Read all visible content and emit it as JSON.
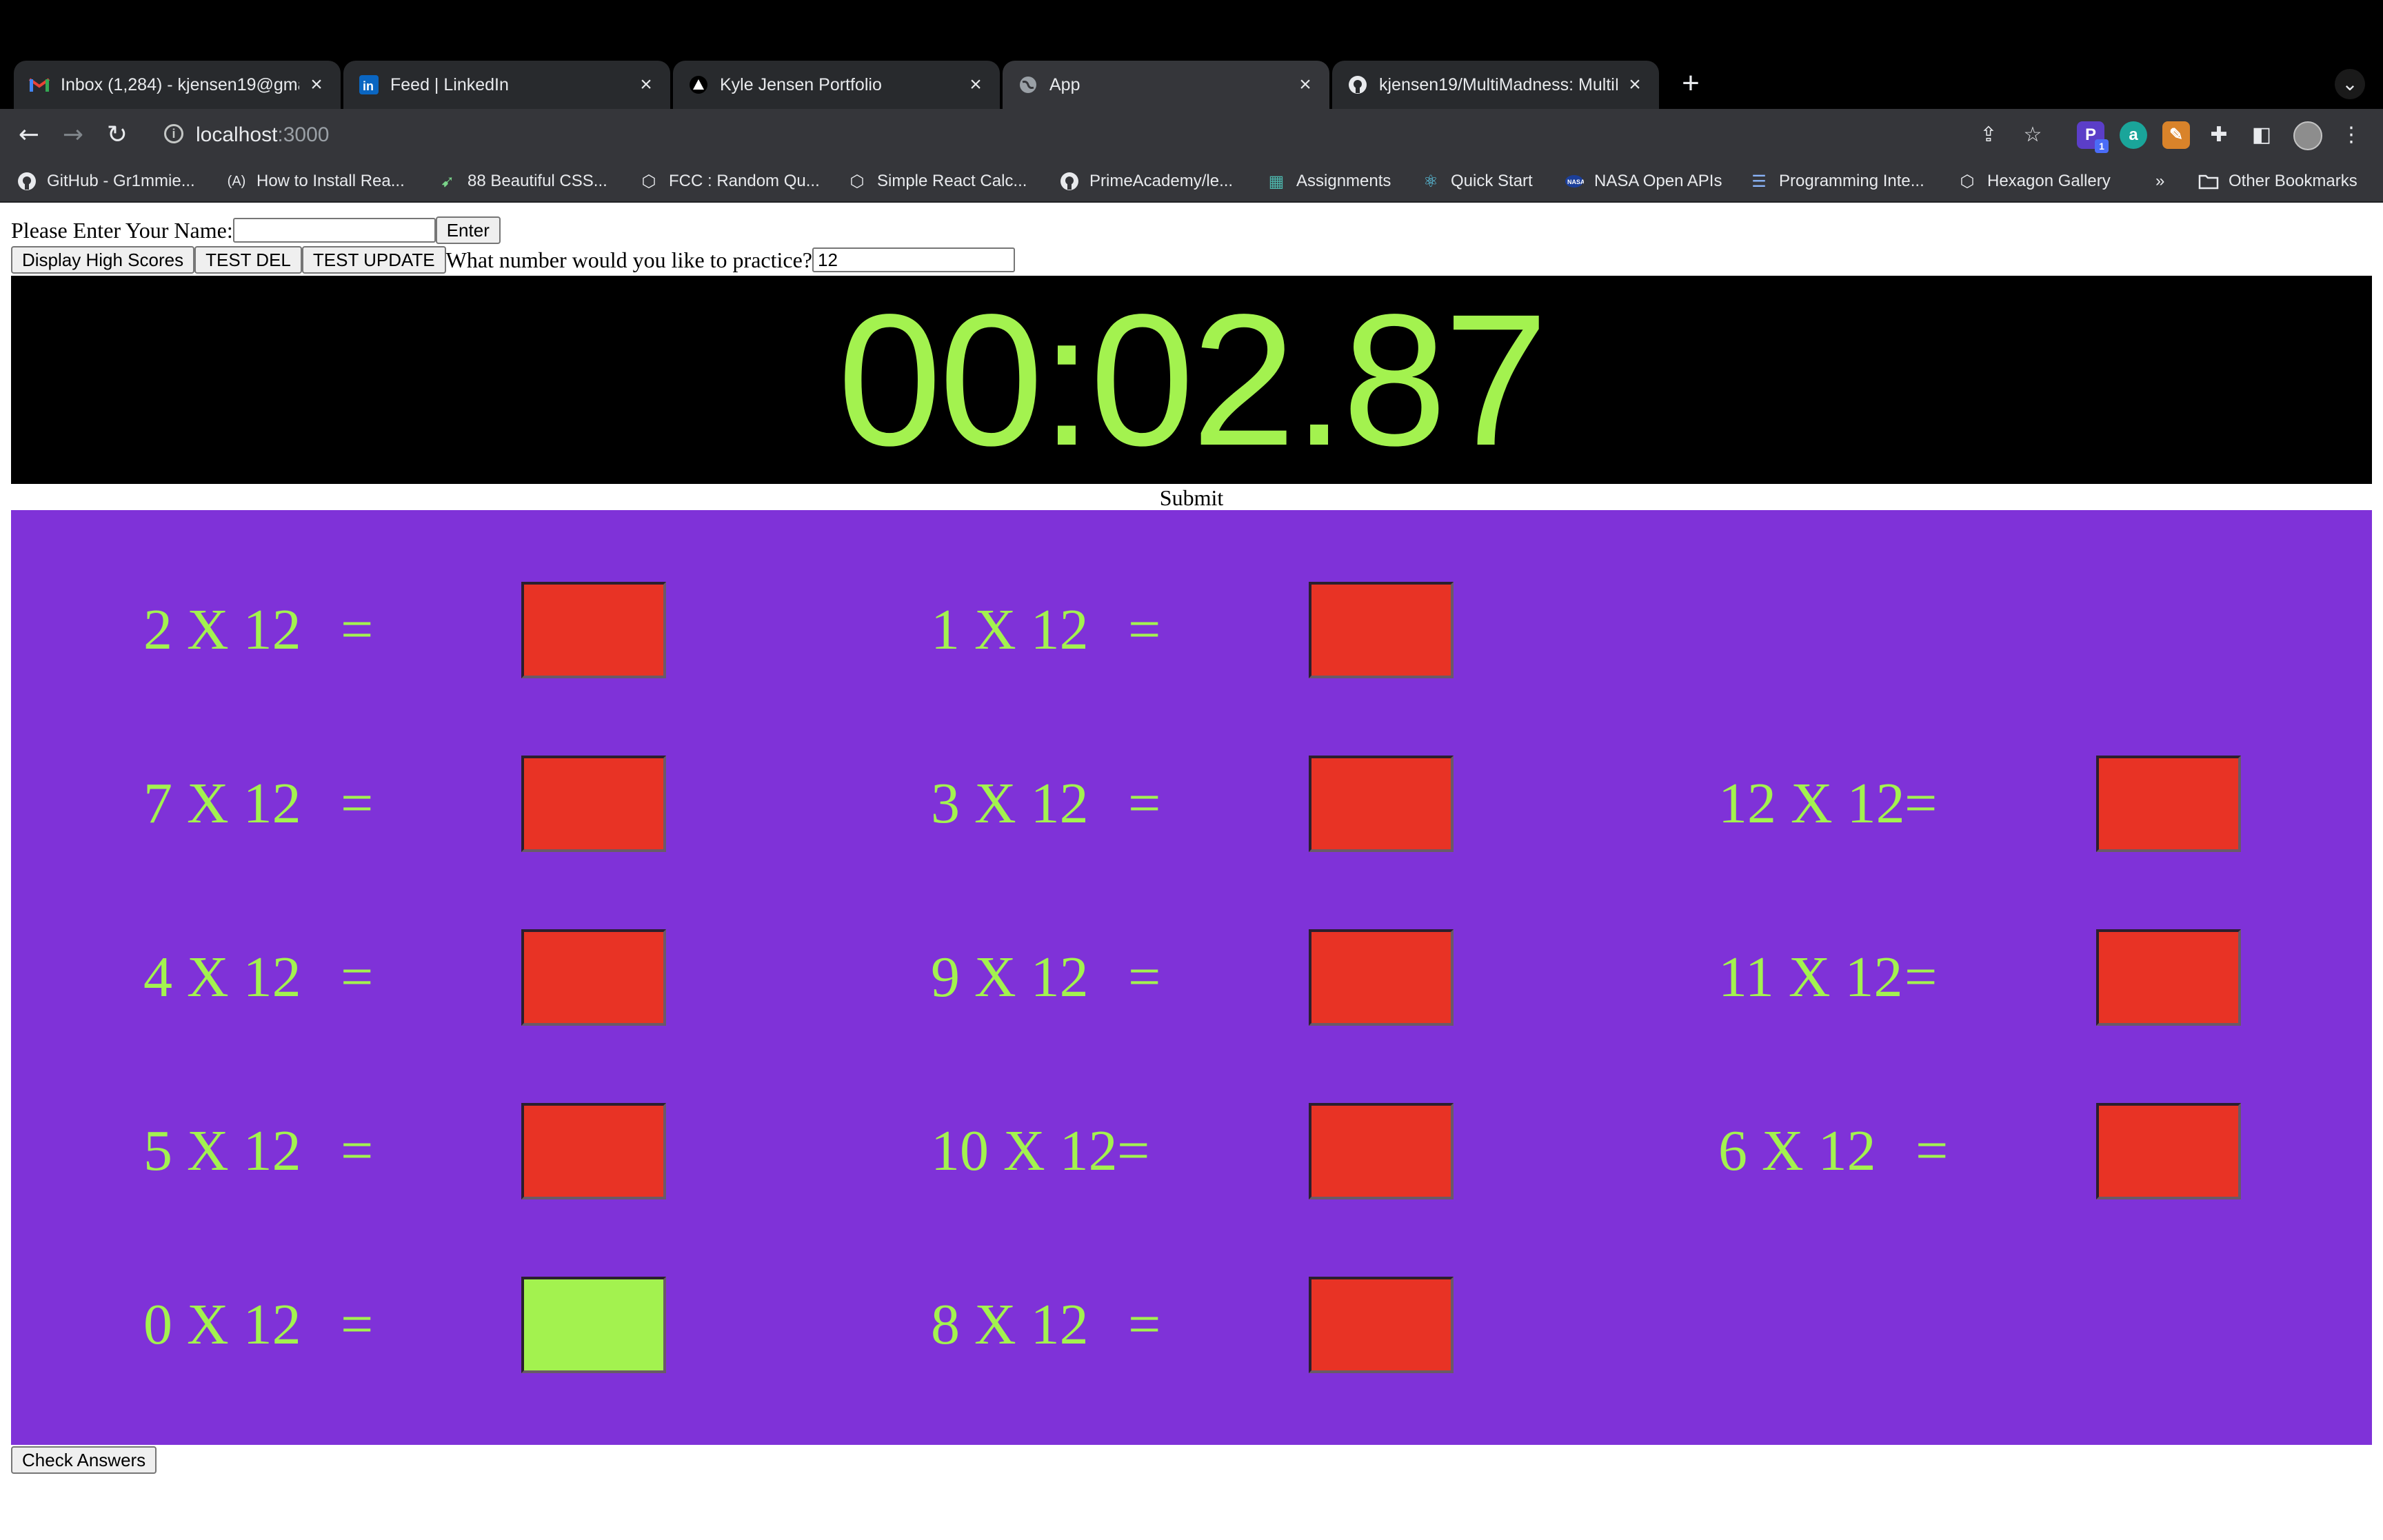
{
  "browser": {
    "tabs": [
      {
        "title": "Inbox (1,284) - kjensen19@gmail.com",
        "icon": "gmail-icon",
        "active": false
      },
      {
        "title": "Feed | LinkedIn",
        "icon": "linkedin-icon",
        "active": false
      },
      {
        "title": "Kyle Jensen Portfolio",
        "icon": "triangle-icon",
        "active": false
      },
      {
        "title": "App",
        "icon": "globe-icon",
        "active": true
      },
      {
        "title": "kjensen19/MultiMadness: MultiMadness",
        "icon": "github-icon",
        "active": false
      }
    ],
    "url_host": "localhost",
    "url_port": ":3000",
    "bookmarks": [
      {
        "label": "GitHub - Gr1mmie...",
        "icon": "github-icon"
      },
      {
        "label": "How to Install Rea...",
        "icon": "a-icon"
      },
      {
        "label": "88 Beautiful CSS...",
        "icon": "cursor-icon"
      },
      {
        "label": "FCC : Random Qu...",
        "icon": "codepen-icon"
      },
      {
        "label": "Simple React Calc...",
        "icon": "codepen-icon"
      },
      {
        "label": "PrimeAcademy/le...",
        "icon": "github-icon"
      },
      {
        "label": "Assignments",
        "icon": "grid-icon"
      },
      {
        "label": "Quick Start",
        "icon": "react-icon"
      },
      {
        "label": "NASA Open APIs",
        "icon": "nasa-icon"
      },
      {
        "label": "Programming Inte...",
        "icon": "stack-icon"
      },
      {
        "label": "Hexagon Gallery",
        "icon": "codepen-icon"
      }
    ],
    "more_bookmarks": "»",
    "other_bookmarks": "Other Bookmarks",
    "extension_badge": "1"
  },
  "page": {
    "name_prompt": "Please Enter Your Name:",
    "name_value": "",
    "enter_label": "Enter",
    "high_scores_label": "Display High Scores",
    "test_del_label": "TEST DEL",
    "test_update_label": "TEST UPDATE",
    "practice_prompt": "What number would you like to practice?",
    "practice_value": "12",
    "timer": "00:02.87",
    "submit_label": "Submit",
    "check_label": "Check Answers",
    "colors": {
      "accent_green": "#a3f24f",
      "grid_purple": "#7f32d8",
      "wrong_red": "#e83325",
      "correct_green": "#a3f24f"
    },
    "problems": [
      {
        "text": "2 X 12",
        "eq": "=",
        "status": "wrong"
      },
      {
        "text": "1 X 12",
        "eq": "=",
        "status": "wrong"
      },
      {
        "text": "7 X 12",
        "eq": "=",
        "status": "wrong"
      },
      {
        "text": "3 X 12",
        "eq": "=",
        "status": "wrong"
      },
      {
        "text": "12 X 12",
        "eq": "=",
        "status": "wrong"
      },
      {
        "text": "4 X 12",
        "eq": "=",
        "status": "wrong"
      },
      {
        "text": "9 X 12",
        "eq": "=",
        "status": "wrong"
      },
      {
        "text": "11 X 12",
        "eq": "=",
        "status": "wrong"
      },
      {
        "text": "5 X 12",
        "eq": "=",
        "status": "wrong"
      },
      {
        "text": "10 X 12",
        "eq": "=",
        "status": "wrong"
      },
      {
        "text": "6 X 12",
        "eq": "=",
        "status": "wrong"
      },
      {
        "text": "0 X 12",
        "eq": "=",
        "status": "correct"
      },
      {
        "text": "8 X 12",
        "eq": "=",
        "status": "wrong"
      }
    ]
  }
}
